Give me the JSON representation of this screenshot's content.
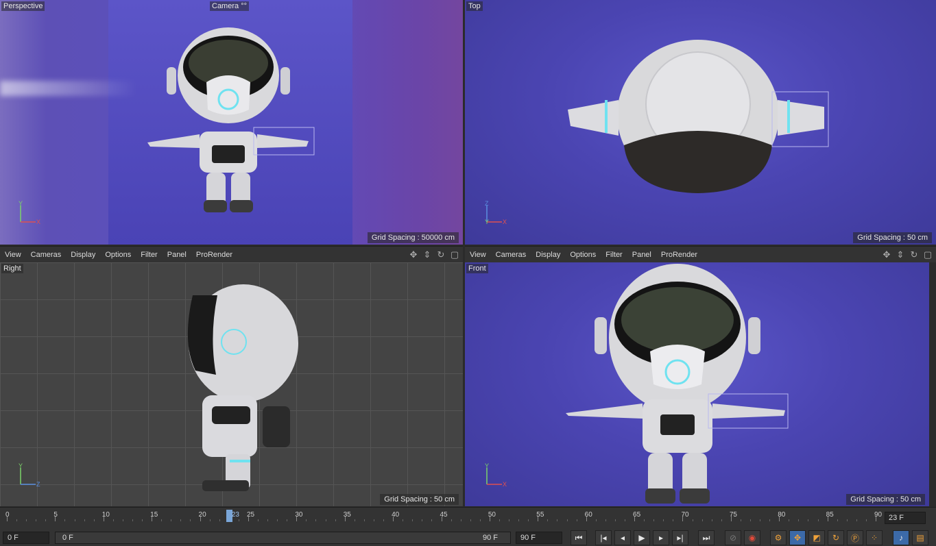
{
  "viewports": {
    "perspective": {
      "label": "Perspective",
      "camera_label": "Camera",
      "grid_spacing": "Grid Spacing : 50000 cm"
    },
    "top": {
      "label": "Top",
      "grid_spacing": "Grid Spacing : 50 cm"
    },
    "right": {
      "label": "Right",
      "grid_spacing": "Grid Spacing : 50 cm"
    },
    "front": {
      "label": "Front",
      "grid_spacing": "Grid Spacing : 50 cm"
    }
  },
  "menu": [
    "View",
    "Cameras",
    "Display",
    "Options",
    "Filter",
    "Panel",
    "ProRender"
  ],
  "menu_tools": [
    "move-view-icon",
    "dolly-view-icon",
    "rotate-view-icon",
    "maximize-view-icon"
  ],
  "axes": {
    "x": "X",
    "y": "Y",
    "z": "Z"
  },
  "axis_colors": {
    "x": "#e05050",
    "y": "#7bd36a",
    "z": "#5a8ee0"
  },
  "timeline": {
    "ticks": [
      "0",
      "5",
      "10",
      "15",
      "20",
      "25",
      "30",
      "35",
      "40",
      "45",
      "50",
      "55",
      "60",
      "65",
      "70",
      "75",
      "80",
      "85",
      "90"
    ],
    "current_frame": "23",
    "current_frame_field": "23 F",
    "start_field": "0 F",
    "slider_start": "0 F",
    "slider_end": "90 F",
    "end_field": "90 F"
  },
  "transport": [
    "go-to-start-icon",
    "previous-key-icon",
    "previous-frame-icon",
    "play-icon",
    "next-frame-icon",
    "next-key-icon",
    "go-to-end-icon"
  ],
  "record_tools": [
    "record-inactive-icon",
    "autokey-icon",
    "keyframe-selection-icon",
    "position-key-icon",
    "scale-key-icon",
    "rotation-key-icon",
    "parameter-key-icon",
    "point-level-icon",
    "sound-icon",
    "film-icon"
  ],
  "colors": {
    "viewport_bg": "#4b45b2",
    "accent": "#3c6aa8",
    "playhead": "#7aa6d8"
  }
}
